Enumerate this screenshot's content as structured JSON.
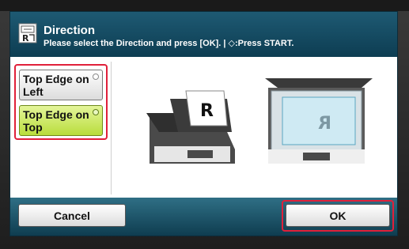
{
  "header": {
    "title": "Direction",
    "instruction": "Please select the Direction and press [OK]. | ◇:Press START."
  },
  "options": [
    {
      "label": "Top Edge on Left",
      "selected": false
    },
    {
      "label": "Top Edge on Top",
      "selected": true
    }
  ],
  "illustration": {
    "original_letter": "R",
    "mirrored_letter": "R"
  },
  "footer": {
    "cancel_label": "Cancel",
    "ok_label": "OK"
  },
  "colors": {
    "header": "#0d3d52",
    "selected_option": "#b9dd3c",
    "highlight_outline": "#e0203a"
  }
}
